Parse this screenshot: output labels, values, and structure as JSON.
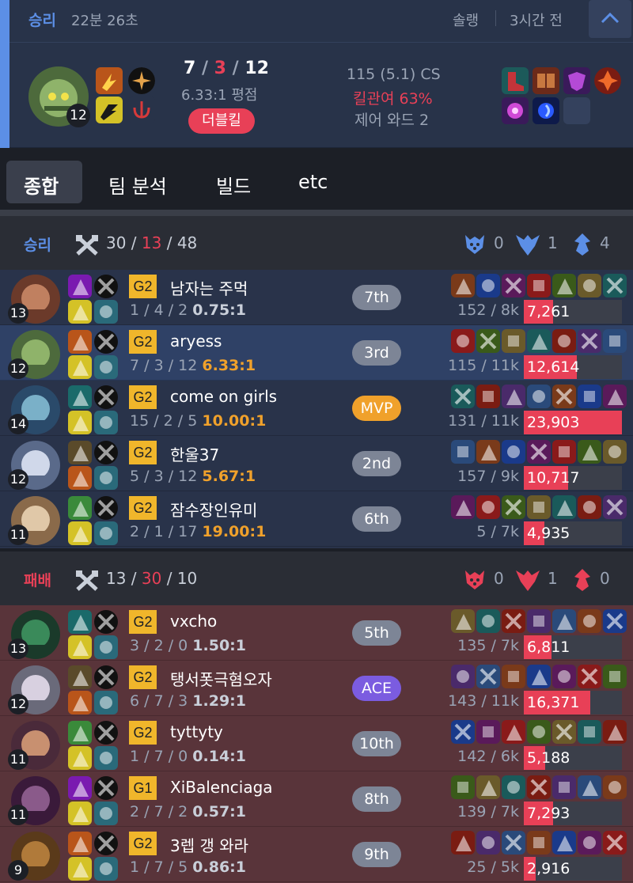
{
  "summary": {
    "result": "승리",
    "duration": "22분 26초",
    "queue": "솔랭",
    "time_ago": "3시간 전",
    "champ_level": "12",
    "kda": {
      "kills": "7",
      "deaths": "3",
      "assists": "12"
    },
    "kda_ratio": "6.33:1 평점",
    "multikill": "더블킬",
    "cs": "115 (5.1) CS",
    "kill_participation": "킬관여 63%",
    "control_wards": "제어 와드 2"
  },
  "tabs": [
    "종합",
    "팀 분석",
    "빌드",
    "etc"
  ],
  "teams": [
    {
      "result": "승리",
      "kills": "30",
      "deaths": "13",
      "assists": "48",
      "objectives": [
        "0",
        "1",
        "4"
      ],
      "players": [
        {
          "level": "13",
          "tier": "G2",
          "name": "남자는 주먹",
          "kda": "1 / 4 / 2",
          "ratio": "0.75:1",
          "rank": "7th",
          "cs": "152 / 8k",
          "damage": "7,261",
          "damage_frac": 0.3
        },
        {
          "level": "12",
          "tier": "G2",
          "name": "aryess",
          "kda": "7 / 3 / 12",
          "ratio": "6.33:1",
          "rank": "3rd",
          "cs": "115 / 11k",
          "damage": "12,614",
          "damage_frac": 0.54
        },
        {
          "level": "14",
          "tier": "G2",
          "name": "come on girls",
          "kda": "15 / 2 / 5",
          "ratio": "10.00:1",
          "rank": "MVP",
          "cs": "131 / 11k",
          "damage": "23,903",
          "damage_frac": 1.0
        },
        {
          "level": "12",
          "tier": "G2",
          "name": "한울37",
          "kda": "5 / 3 / 12",
          "ratio": "5.67:1",
          "rank": "2nd",
          "cs": "157 / 9k",
          "damage": "10,717",
          "damage_frac": 0.45
        },
        {
          "level": "11",
          "tier": "G2",
          "name": "잠수장인유미",
          "kda": "2 / 1 / 17",
          "ratio": "19.00:1",
          "rank": "6th",
          "cs": "5 / 7k",
          "damage": "4,935",
          "damage_frac": 0.21
        }
      ]
    },
    {
      "result": "패배",
      "kills": "13",
      "deaths": "30",
      "assists": "10",
      "objectives": [
        "0",
        "1",
        "0"
      ],
      "players": [
        {
          "level": "13",
          "tier": "G2",
          "name": "vxcho",
          "kda": "3 / 2 / 0",
          "ratio": "1.50:1",
          "rank": "5th",
          "cs": "135 / 7k",
          "damage": "6,811",
          "damage_frac": 0.28
        },
        {
          "level": "12",
          "tier": "G2",
          "name": "탱서폿극혐오자",
          "kda": "6 / 7 / 3",
          "ratio": "1.29:1",
          "rank": "ACE",
          "cs": "143 / 11k",
          "damage": "16,371",
          "damage_frac": 0.68
        },
        {
          "level": "11",
          "tier": "G2",
          "name": "tyttyty",
          "kda": "1 / 7 / 0",
          "ratio": "0.14:1",
          "rank": "10th",
          "cs": "142 / 6k",
          "damage": "5,188",
          "damage_frac": 0.22
        },
        {
          "level": "11",
          "tier": "G1",
          "name": "XiBalenciaga",
          "kda": "2 / 7 / 2",
          "ratio": "0.57:1",
          "rank": "8th",
          "cs": "139 / 7k",
          "damage": "7,293",
          "damage_frac": 0.3
        },
        {
          "level": "9",
          "tier": "G2",
          "name": "3렙 갱 와라",
          "kda": "1 / 7 / 5",
          "ratio": "0.86:1",
          "rank": "9th",
          "cs": "25 / 5k",
          "damage": "2,916",
          "damage_frac": 0.12
        }
      ]
    }
  ],
  "colors": {
    "win": "#5c8fe6",
    "lose": "#e84057",
    "gold_badge": "#f0b62b",
    "mvp": "#f0a12b",
    "ace": "#7b5ce0"
  }
}
